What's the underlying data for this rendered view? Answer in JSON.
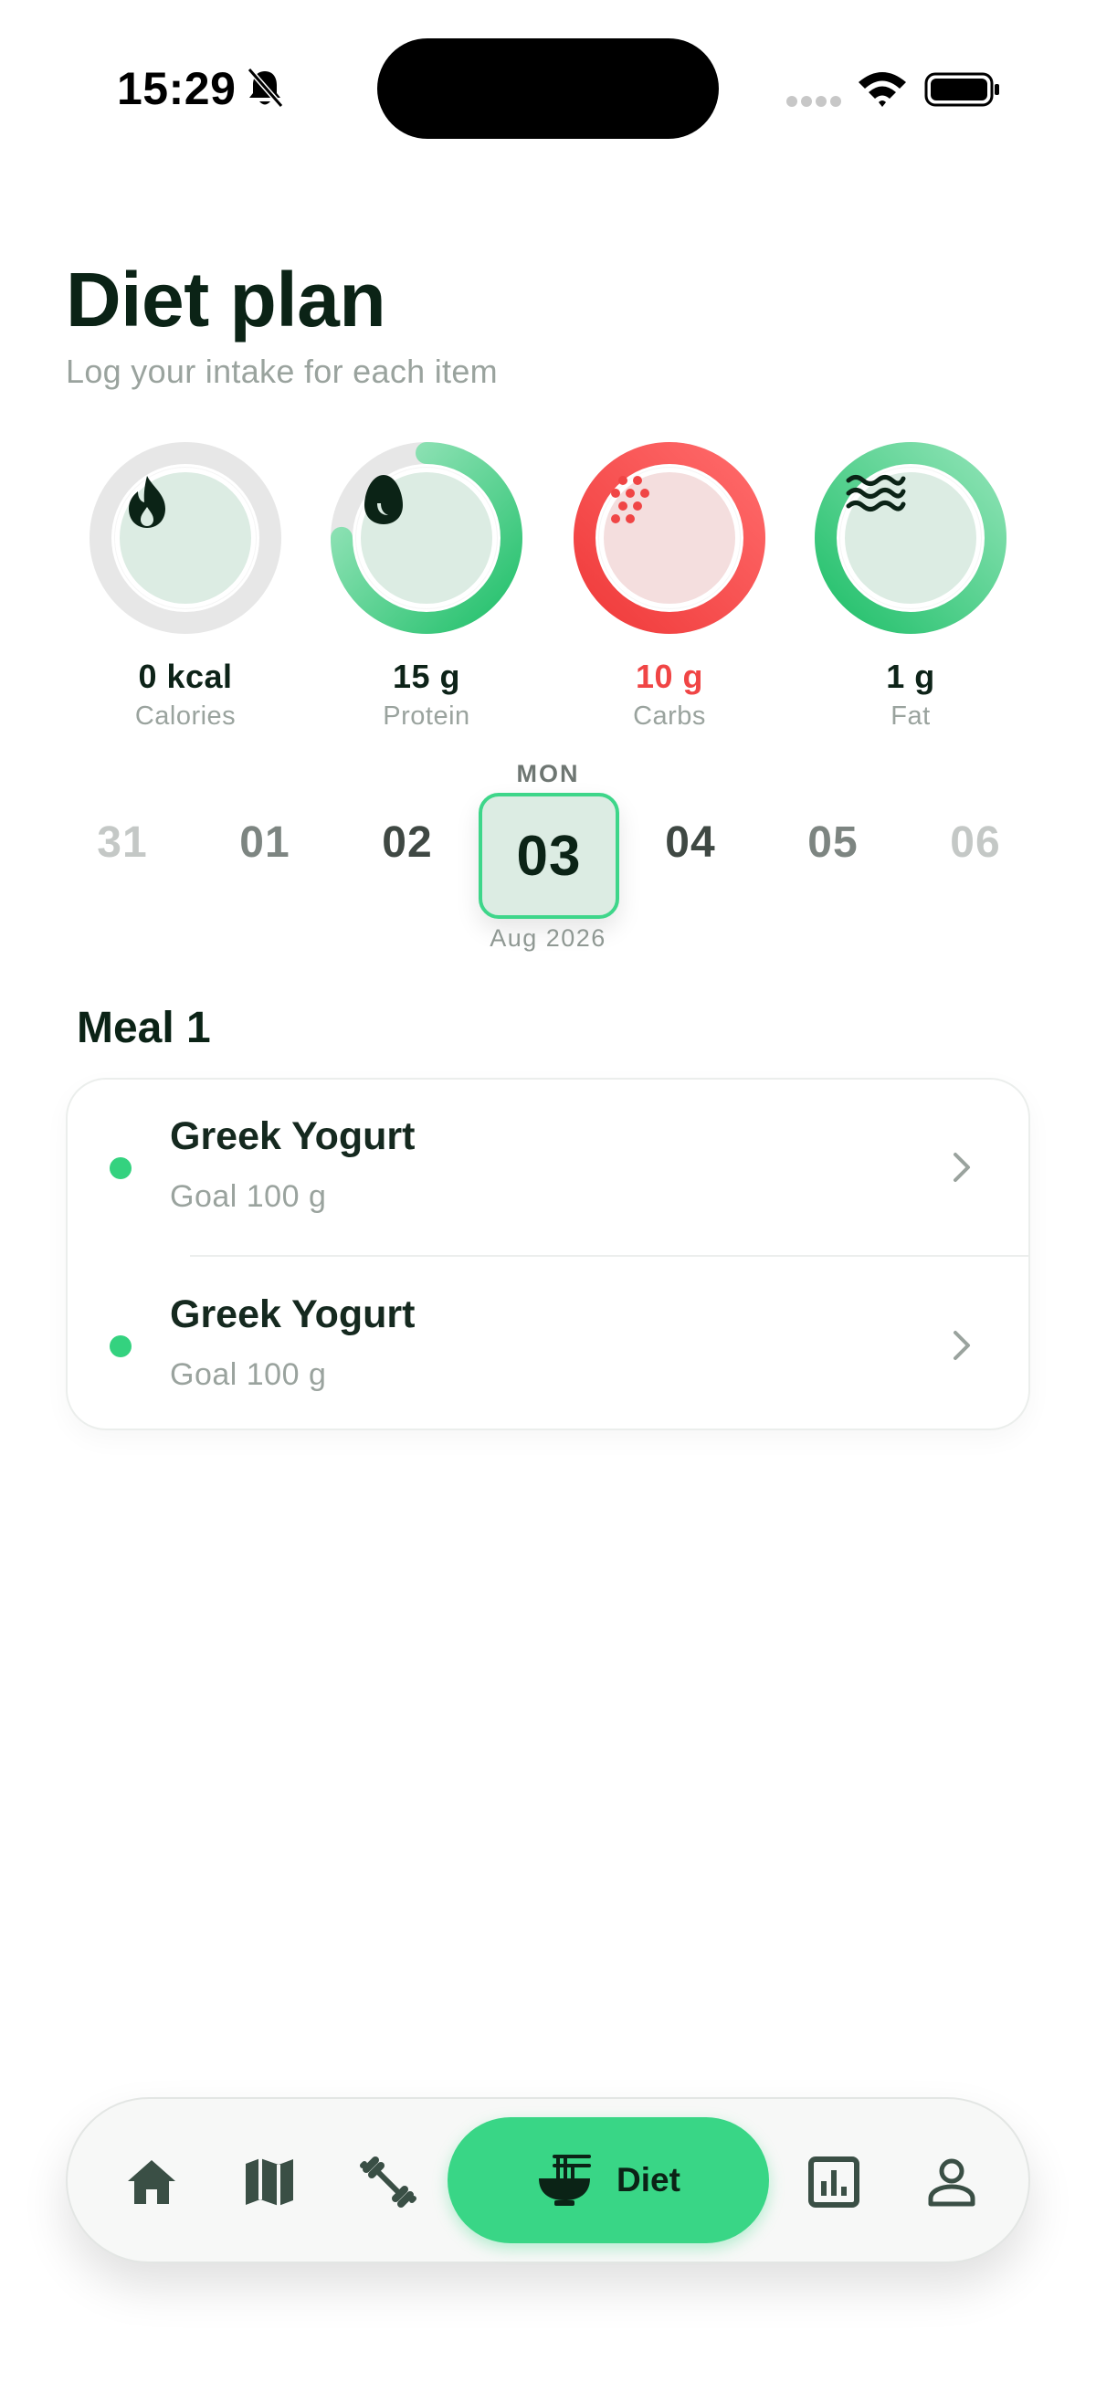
{
  "status": {
    "time": "15:29"
  },
  "header": {
    "title": "Diet plan",
    "subtitle": "Log your intake for each item"
  },
  "macros": [
    {
      "value": "0 kcal",
      "label": "Calories",
      "progress": 0,
      "icon": "flame-icon"
    },
    {
      "value": "15 g",
      "label": "Protein",
      "progress": 0.75,
      "icon": "egg-icon"
    },
    {
      "value": "10 g",
      "label": "Carbs",
      "progress": 1.0,
      "over_limit": true,
      "icon": "grain-dots-icon"
    },
    {
      "value": "1 g",
      "label": "Fat",
      "progress": 1.0,
      "icon": "waves-icon"
    }
  ],
  "calendar": {
    "weekday": "MON",
    "days": [
      "31",
      "01",
      "02",
      "03",
      "04",
      "05",
      "06"
    ],
    "selected": "03",
    "month": "Aug 2026"
  },
  "meal": {
    "title": "Meal 1",
    "items": [
      {
        "name": "Greek Yogurt",
        "goal": "Goal 100 g"
      },
      {
        "name": "Greek Yogurt",
        "goal": "Goal 100 g"
      }
    ]
  },
  "tabbar": {
    "tabs": [
      "home-icon",
      "map-icon",
      "dumbbell-icon",
      "noodle-bowl-icon",
      "chart-icon",
      "profile-icon"
    ],
    "active_label": "Diet"
  },
  "colors": {
    "accent": "#39d686",
    "ring_track": "#e7e7e7",
    "alert": "#f04545",
    "text": "#0b2316"
  }
}
